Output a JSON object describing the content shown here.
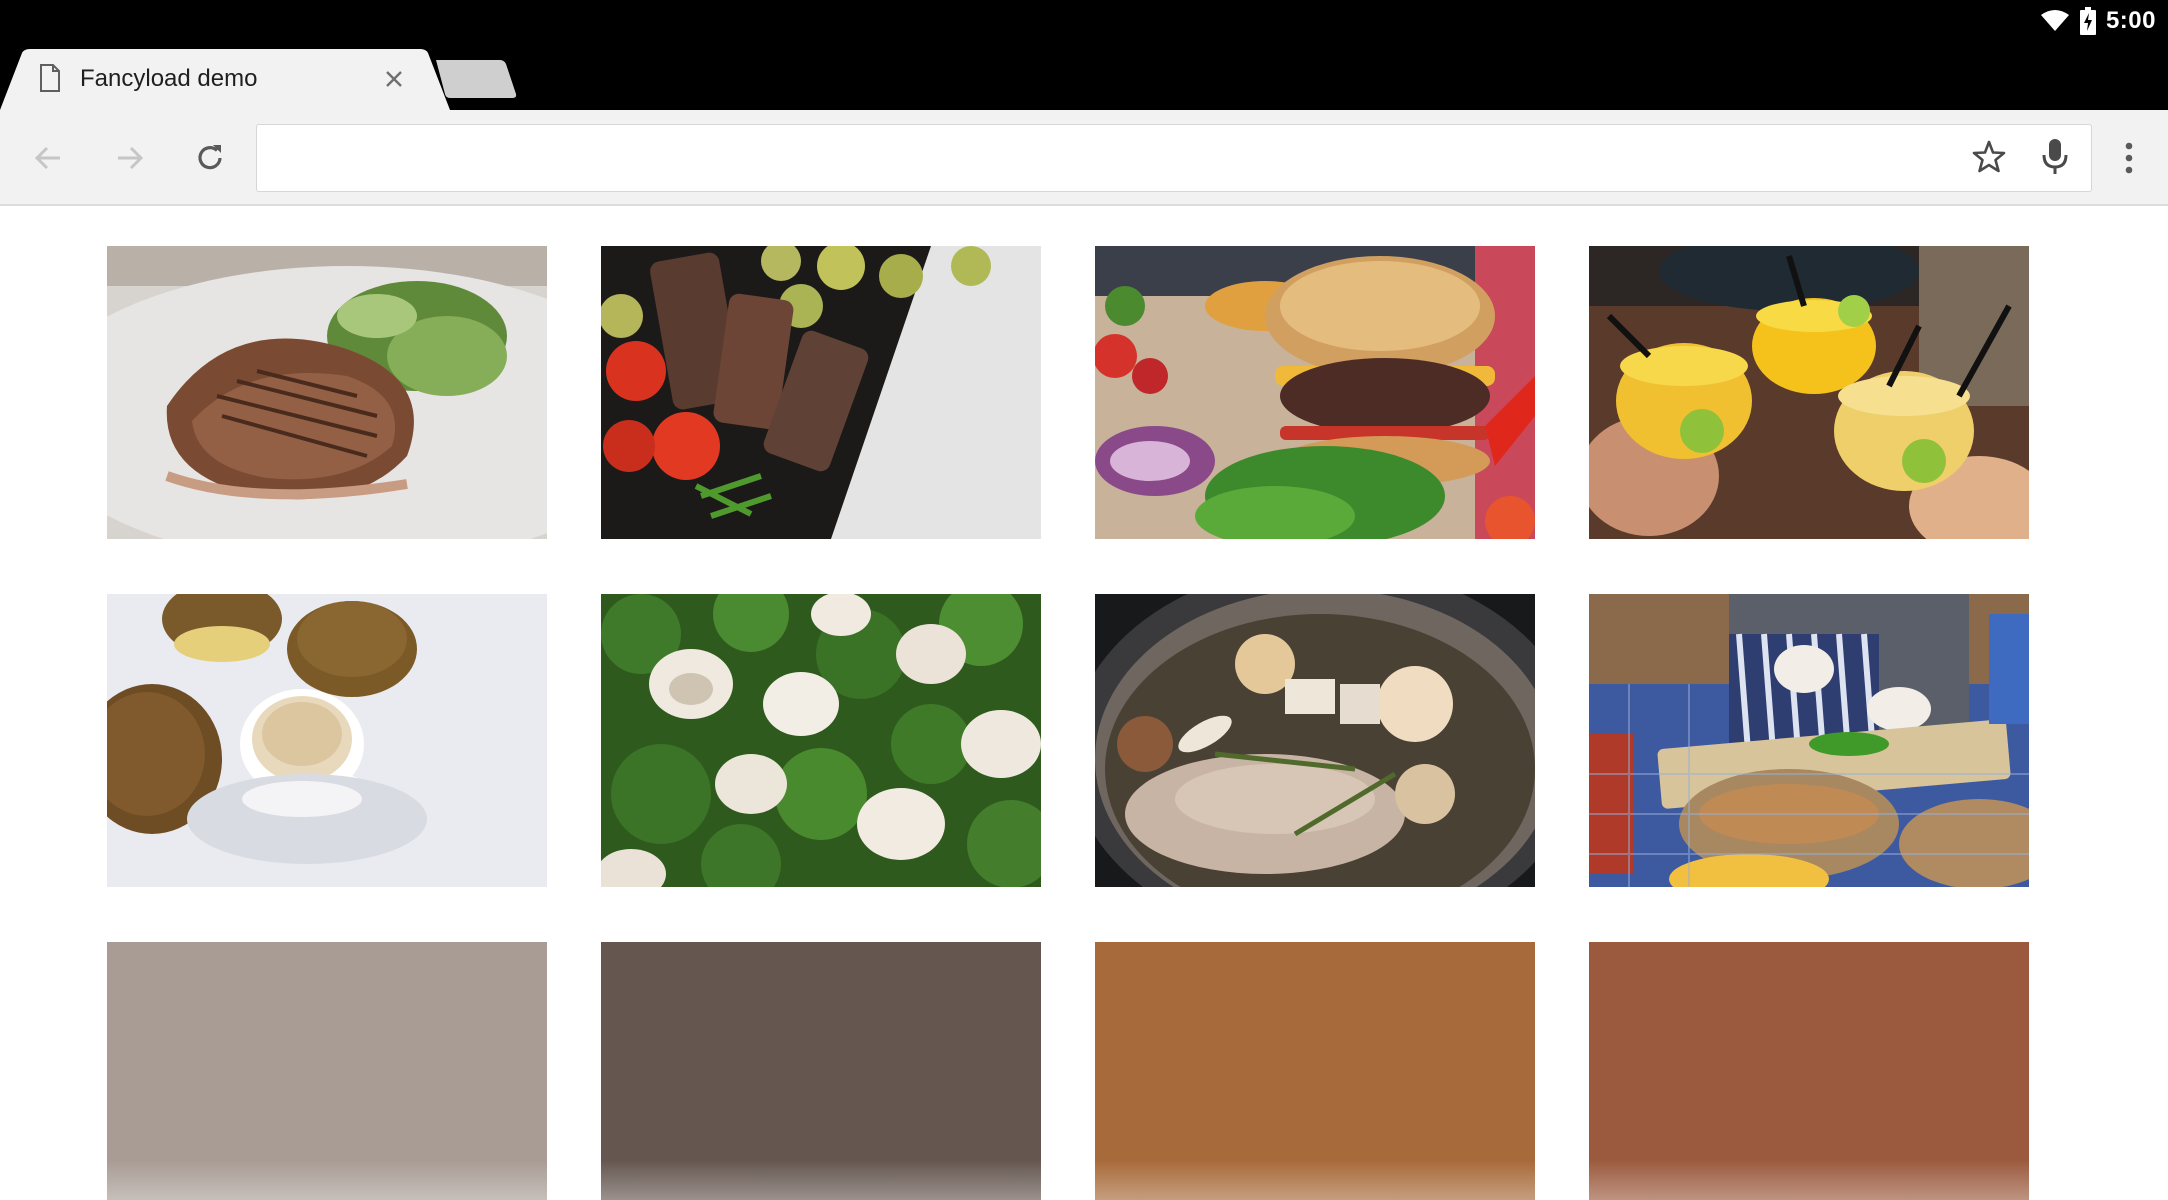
{
  "status_bar": {
    "time": "5:00",
    "icons": [
      "wifi-icon",
      "battery-charging-icon"
    ]
  },
  "tabs": [
    {
      "title": "Fancyload demo",
      "icon": "page-icon",
      "active": true
    }
  ],
  "toolbar": {
    "back_icon": "arrow-back-icon",
    "forward_icon": "arrow-forward-icon",
    "reload_icon": "reload-icon",
    "url": "",
    "bookmark_icon": "star-icon",
    "voice_icon": "mic-icon",
    "menu_icon": "more-vert-icon"
  },
  "gallery": {
    "photos": [
      {
        "subject": "grilled steak with salad"
      },
      {
        "subject": "steak pieces with tomatoes and zucchini"
      },
      {
        "subject": "burger with vegetables"
      },
      {
        "subject": "yellow cocktails with lime"
      },
      {
        "subject": "muffins with coffee cup"
      },
      {
        "subject": "broccoli and mushrooms"
      },
      {
        "subject": "chicken soup in pot"
      },
      {
        "subject": "chef chopping herbs"
      }
    ],
    "placeholders": [
      {
        "color": "#a89c95"
      },
      {
        "color": "#655650"
      },
      {
        "color": "#a76a3a"
      },
      {
        "color": "#9b5a3e"
      }
    ]
  }
}
